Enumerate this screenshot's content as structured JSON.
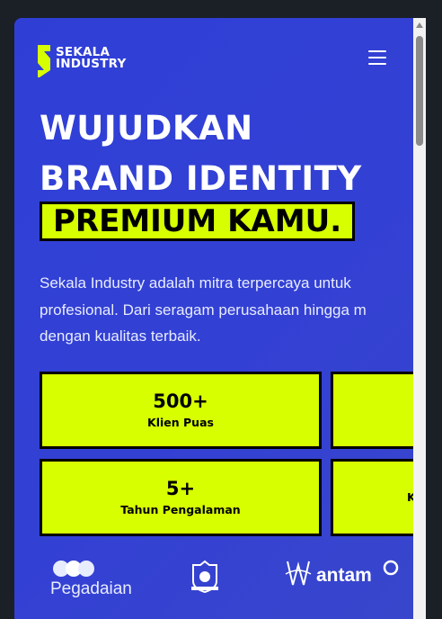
{
  "header": {
    "logo_line1": "SEKALA",
    "logo_line2": "INDUSTRY",
    "menu_icon": "hamburger-menu-icon"
  },
  "hero": {
    "headline_line1": "WUJUDKAN",
    "headline_line2": "BRAND IDENTITY",
    "highlight": "PREMIUM KAMU.",
    "description_line1": "Sekala Industry adalah mitra terpercaya untuk",
    "description_line2": "profesional. Dari seragam perusahaan hingga m",
    "description_line3": "dengan kualitas terbaik."
  },
  "stats": [
    {
      "value": "500+",
      "label": "Klien Puas"
    },
    {
      "value": "",
      "label": ""
    },
    {
      "value": "5+",
      "label": "Tahun Pengalaman"
    },
    {
      "value": "",
      "label": "K"
    }
  ],
  "partners": [
    {
      "name": "Pegadaian"
    },
    {
      "name": "",
      "icon": "municipal-crest-icon"
    },
    {
      "name": "antam"
    }
  ],
  "colors": {
    "background": "#3340d4",
    "accent": "#d8ff00",
    "outline": "#000000",
    "text": "#ffffff"
  }
}
